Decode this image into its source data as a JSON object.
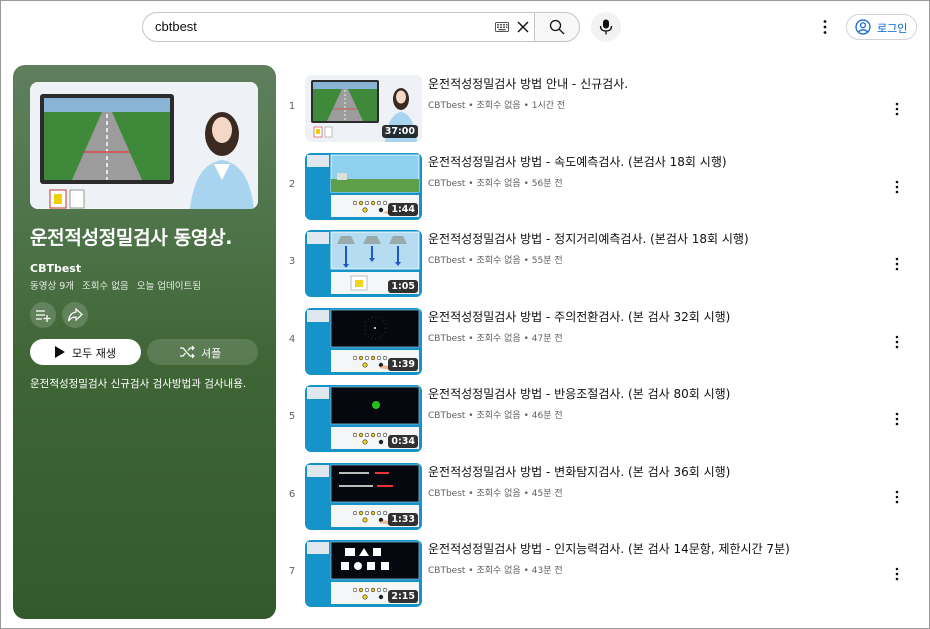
{
  "search": {
    "value": "cbtbest"
  },
  "header": {
    "login_label": "로그인"
  },
  "playlist": {
    "title": "운전적성정밀검사 동영상.",
    "channel": "CBTbest",
    "video_count": "동영상 9개",
    "views": "조회수 없음",
    "updated": "오늘 업데이트됨",
    "play_all_label": "모두 재생",
    "shuffle_label": "셔플",
    "description": "운전적성정밀검사 신규검사 검사방법과 검사내용."
  },
  "videos": [
    {
      "index": "1",
      "title": "운전적성정밀검사 방법 안내 - 신규검사.",
      "meta": "CBTbest • 조회수 없음 • 1시간 전",
      "duration": "37:00"
    },
    {
      "index": "2",
      "title": "운전적성정밀검사 방법 - 속도예측검사. (본검사 18회 시행)",
      "meta": "CBTbest • 조회수 없음 • 56분 전",
      "duration": "1:44"
    },
    {
      "index": "3",
      "title": "운전적성정밀검사 방법 - 정지거리예측검사. (본검사 18회 시행)",
      "meta": "CBTbest • 조회수 없음 • 55분 전",
      "duration": "1:05"
    },
    {
      "index": "4",
      "title": "운전적성정밀검사 방법 - 주의전환검사. (본 검사 32회 시행)",
      "meta": "CBTbest • 조회수 없음 • 47분 전",
      "duration": "1:39"
    },
    {
      "index": "5",
      "title": "운전적성정밀검사 방법 - 반응조절검사. (본 검사 80회 시행)",
      "meta": "CBTbest • 조회수 없음 • 46분 전",
      "duration": "0:34"
    },
    {
      "index": "6",
      "title": "운전적성정밀검사 방법 - 변화탐지검사. (본 검사 36회 시행)",
      "meta": "CBTbest • 조회수 없음 • 45분 전",
      "duration": "1:33"
    },
    {
      "index": "7",
      "title": "운전적성정밀검사 방법 - 인지능력검사. (본 검사 14문항, 제한시간 7분)",
      "meta": "CBTbest • 조회수 없음 • 43분 전",
      "duration": "2:15"
    }
  ],
  "icons": {
    "keyboard": "keyboard-icon",
    "clear": "close-icon",
    "search": "search-icon",
    "mic": "microphone-icon",
    "more": "more-vert-icon",
    "account": "account-circle-icon",
    "add_playlist": "playlist-add-icon",
    "share": "share-icon",
    "play": "play-icon",
    "shuffle": "shuffle-icon"
  },
  "colors": {
    "panel": "#3f6536",
    "link_blue": "#065fd4",
    "thumb_blue": "#1693c8"
  }
}
